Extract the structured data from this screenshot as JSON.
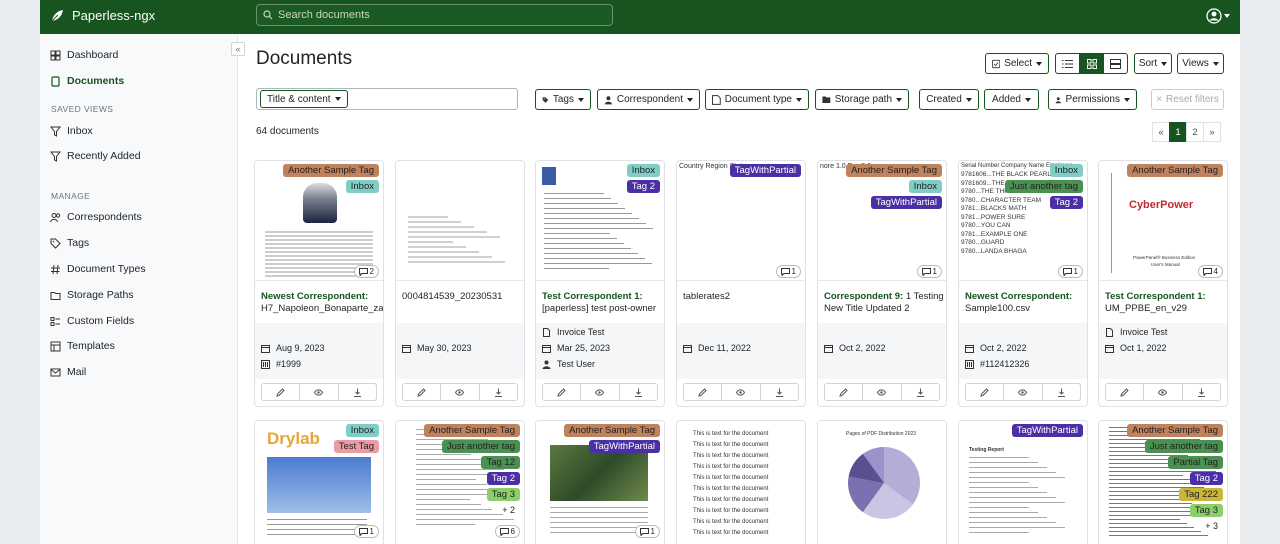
{
  "app": {
    "name": "Paperless-ngx",
    "search_placeholder": "Search documents"
  },
  "sidebar": {
    "items": [
      {
        "label": "Dashboard"
      },
      {
        "label": "Documents"
      }
    ],
    "saved_views_title": "SAVED VIEWS",
    "saved_views": [
      {
        "label": "Inbox"
      },
      {
        "label": "Recently Added"
      }
    ],
    "manage_title": "MANAGE",
    "manage": [
      {
        "label": "Correspondents"
      },
      {
        "label": "Tags"
      },
      {
        "label": "Document Types"
      },
      {
        "label": "Storage Paths"
      },
      {
        "label": "Custom Fields"
      },
      {
        "label": "Templates"
      },
      {
        "label": "Mail"
      }
    ]
  },
  "page": {
    "title": "Documents",
    "count": "64 documents"
  },
  "toolbar": {
    "select": "Select",
    "sort": "Sort",
    "views": "Views"
  },
  "filters": {
    "title_content": "Title & content",
    "tags": "Tags",
    "correspondent": "Correspondent",
    "document_type": "Document type",
    "storage_path": "Storage path",
    "created": "Created",
    "added": "Added",
    "permissions": "Permissions",
    "reset": "Reset filters"
  },
  "pagination": {
    "prev": "«",
    "pages": [
      "1",
      "2"
    ],
    "next": "»"
  },
  "colors": {
    "accent": "#17541f",
    "tag_sample": "#c0825c",
    "tag_inbox": "#7fcdc5",
    "tag_partial": "#4b2fa6",
    "tag_tag2": "#4b2fa6",
    "tag_just": "#4a9151",
    "tag_test": "#ea9ba5",
    "tag_tag12": "#4a9151",
    "tag_tag3": "#8ccf6a",
    "tag_tag222": "#c9b63a"
  },
  "cards": [
    {
      "tags": [
        "Another Sample Tag",
        "Inbox"
      ],
      "notes": "2",
      "correspondent": "Newest Correspondent",
      "title": "H7_Napoleon_Bonaparte_zadanie",
      "date": "Aug 9, 2023",
      "doc_type": "",
      "owner": "",
      "asn": "#1999"
    },
    {
      "tags": [],
      "notes": "",
      "correspondent": "",
      "title": "0004814539_20230531",
      "date": "May 30, 2023",
      "doc_type": "",
      "owner": "",
      "asn": ""
    },
    {
      "tags": [
        "Inbox",
        "Tag 2"
      ],
      "notes": "",
      "correspondent": "Test Correspondent 1",
      "title": "[paperless] test post-owner",
      "date": "Mar 25, 2023",
      "doc_type": "Invoice Test",
      "owner": "Test User",
      "asn": ""
    },
    {
      "tags": [
        "TagWithPartial"
      ],
      "notes": "1",
      "correspondent": "",
      "title": "tablerates2",
      "date": "Dec 11, 2022",
      "doc_type": "",
      "owner": "",
      "asn": ""
    },
    {
      "tags": [
        "Another Sample Tag",
        "Inbox",
        "TagWithPartial"
      ],
      "notes": "1",
      "correspondent": "Correspondent 9",
      "title": "1 Testing New Title Updated 2",
      "date": "Oct 2, 2022",
      "doc_type": "",
      "owner": "",
      "asn": ""
    },
    {
      "tags": [
        "Inbox",
        "Just another tag",
        "Tag 2"
      ],
      "notes": "1",
      "correspondent": "Newest Correspondent",
      "title": "Sample100.csv",
      "date": "Oct 2, 2022",
      "doc_type": "",
      "owner": "",
      "asn": "#112412326"
    },
    {
      "tags": [
        "Another Sample Tag"
      ],
      "notes": "4",
      "correspondent": "Test Correspondent 1",
      "title": "UM_PPBE_en_v29",
      "date": "Oct 1, 2022",
      "doc_type": "Invoice Test",
      "owner": "",
      "asn": ""
    }
  ],
  "cards_row2": [
    {
      "tags": [
        "Inbox",
        "Test Tag"
      ],
      "notes": "1"
    },
    {
      "tags": [
        "Another Sample Tag",
        "Just another tag",
        "Tag 12",
        "Tag 2",
        "Tag 3"
      ],
      "more": "+ 2",
      "notes": "6"
    },
    {
      "tags": [
        "Another Sample Tag",
        "TagWithPartial"
      ],
      "notes": "1"
    },
    {
      "tags": [],
      "notes": ""
    },
    {
      "tags": [],
      "notes": ""
    },
    {
      "tags": [
        "TagWithPartial"
      ],
      "notes": ""
    },
    {
      "tags": [
        "Another Sample Tag",
        "Just another tag",
        "Partial Tag",
        "Tag 2",
        "Tag 222",
        "Tag 3"
      ],
      "more": "+ 3",
      "notes": ""
    }
  ],
  "thumb_text": {
    "drylab": "Drylab",
    "cyberpower": "CyberPower",
    "cyber_sub": "PowerPanel® Business Edition",
    "cyber_sub2": "User's Manual",
    "csv_header": "Serial Number Company Name Employee",
    "csv_lines": [
      "9781606...THE BLACK PEARL",
      "9781609...THE TOMB",
      "9780...THE THREE WISE",
      "9780...CHARACTER TEAM",
      "9781...BLACKS MATH",
      "9781...POWER SURE",
      "9780...YOU CAN",
      "9781...EXAMPLE ONE",
      "9780...GUARD",
      "9780...LANDA BHAGA"
    ],
    "txt_lines": [
      "This is text for the document",
      "This is text for the document",
      "This is text for the document",
      "This is text for the document",
      "This is text for the document",
      "This is text for the document",
      "This is text for the document",
      "This is text for the document",
      "This is text for the document",
      "This is text for the document"
    ],
    "pie_title": "Pages of PDF Distribution 2023",
    "table_header": "Country Region State",
    "rates_header": "nore 1.0 Fax 5.0",
    "testing_report": "Testing Report"
  }
}
